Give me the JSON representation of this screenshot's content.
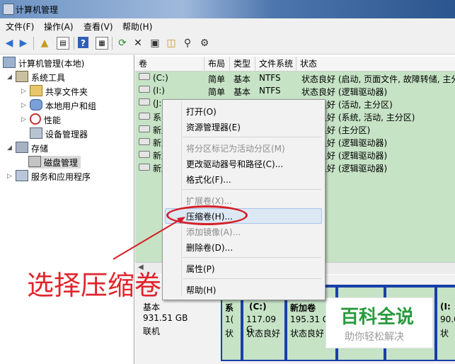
{
  "window": {
    "title": "计算机管理"
  },
  "menubar": [
    "文件(F)",
    "操作(A)",
    "查看(V)",
    "帮助(H)"
  ],
  "toolbar": {
    "icons": [
      "back-arrow-icon",
      "forward-arrow-icon",
      "up-folder-icon",
      "show-hide-tree-icon",
      "help-icon",
      "properties-icon",
      "refresh-icon",
      "delete-icon",
      "map-drive-icon",
      "open-folder-icon",
      "search-icon",
      "settings-icon"
    ]
  },
  "tree": {
    "root": "计算机管理(本地)",
    "system_tools": "系统工具",
    "shared_folders": "共享文件夹",
    "local_users": "本地用户和组",
    "performance": "性能",
    "device_manager": "设备管理器",
    "storage": "存储",
    "disk_management": "磁盘管理",
    "services": "服务和应用程序"
  },
  "table": {
    "headers": [
      "卷",
      "布局",
      "类型",
      "文件系统",
      "状态"
    ],
    "rows": [
      {
        "vol": "(C:)",
        "layout": "简单",
        "type": "基本",
        "fs": "NTFS",
        "status": "状态良好 (启动, 页面文件, 故障转储, 主分"
      },
      {
        "vol": "(I:)",
        "layout": "简单",
        "type": "基本",
        "fs": "NTFS",
        "status": "状态良好 (逻辑驱动器)"
      },
      {
        "vol": "(J:",
        "status": "状态良好 (活动, 主分区)"
      },
      {
        "vol": "系",
        "status": "状态良好 (系统, 活动, 主分区)"
      },
      {
        "vol": "新加",
        "status": "状态良好 (主分区)"
      },
      {
        "vol": "新加",
        "status": "状态良好 (逻辑驱动器)"
      },
      {
        "vol": "新加",
        "status": "状态良好 (逻辑驱动器)"
      },
      {
        "vol": "新加",
        "status": "状态良好 (逻辑驱动器)"
      }
    ]
  },
  "context_menu": {
    "open": "打开(O)",
    "explorer": "资源管理器(E)",
    "mark_active": "将分区标记为活动分区(M)",
    "change_letter": "更改驱动器号和路径(C)...",
    "format": "格式化(F)...",
    "extend": "扩展卷(X)...",
    "shrink": "压缩卷(H)...",
    "add_mirror": "添加镜像(A)...",
    "delete": "删除卷(D)...",
    "properties": "属性(P)",
    "help": "帮助(H)"
  },
  "diskmap": {
    "disk_type": "基本",
    "disk_size": "931.51 GB",
    "disk_status": "联机",
    "p1_label": "系",
    "p1_l2": "1(",
    "p1_l3": "状",
    "p2_name": "(C:)",
    "p2_size": "117.09 G",
    "p2_status": "状态良好",
    "p3_name": "新加卷",
    "p3_size": "195.31 G",
    "p3_status": "状态良好",
    "p4_name": "(I:",
    "p4_size": "90.0",
    "p4_status": "状"
  },
  "annotation": {
    "text": "选择压缩卷",
    "color": "#e0252d"
  },
  "watermark": {
    "title": "百科全说",
    "subtitle": "助你轻松解决"
  }
}
